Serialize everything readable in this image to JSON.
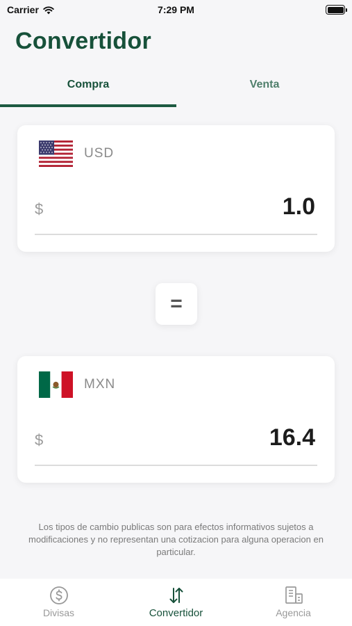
{
  "status_bar": {
    "carrier": "Carrier",
    "time": "7:29 PM"
  },
  "title": "Convertidor",
  "tabs": [
    {
      "label": "Compra",
      "selected": true
    },
    {
      "label": "Venta",
      "selected": false
    }
  ],
  "from": {
    "code": "USD",
    "symbol": "$",
    "amount": "1.0",
    "flag": "us-flag-icon"
  },
  "equals_symbol": "=",
  "to": {
    "code": "MXN",
    "symbol": "$",
    "amount": "16.4",
    "flag": "mx-flag-icon"
  },
  "disclaimer": "Los tipos de cambio publicas son para efectos informativos sujetos a modificaciones y no representan una cotizacion para alguna operacion en particular.",
  "tabbar": [
    {
      "label": "Divisas",
      "icon": "dollar-circle-icon",
      "active": false
    },
    {
      "label": "Convertidor",
      "icon": "swap-arrows-icon",
      "active": true
    },
    {
      "label": "Agencia",
      "icon": "building-icon",
      "active": false
    }
  ],
  "colors": {
    "accent": "#17513a",
    "inactive": "#999999",
    "background": "#f6f6f8"
  }
}
